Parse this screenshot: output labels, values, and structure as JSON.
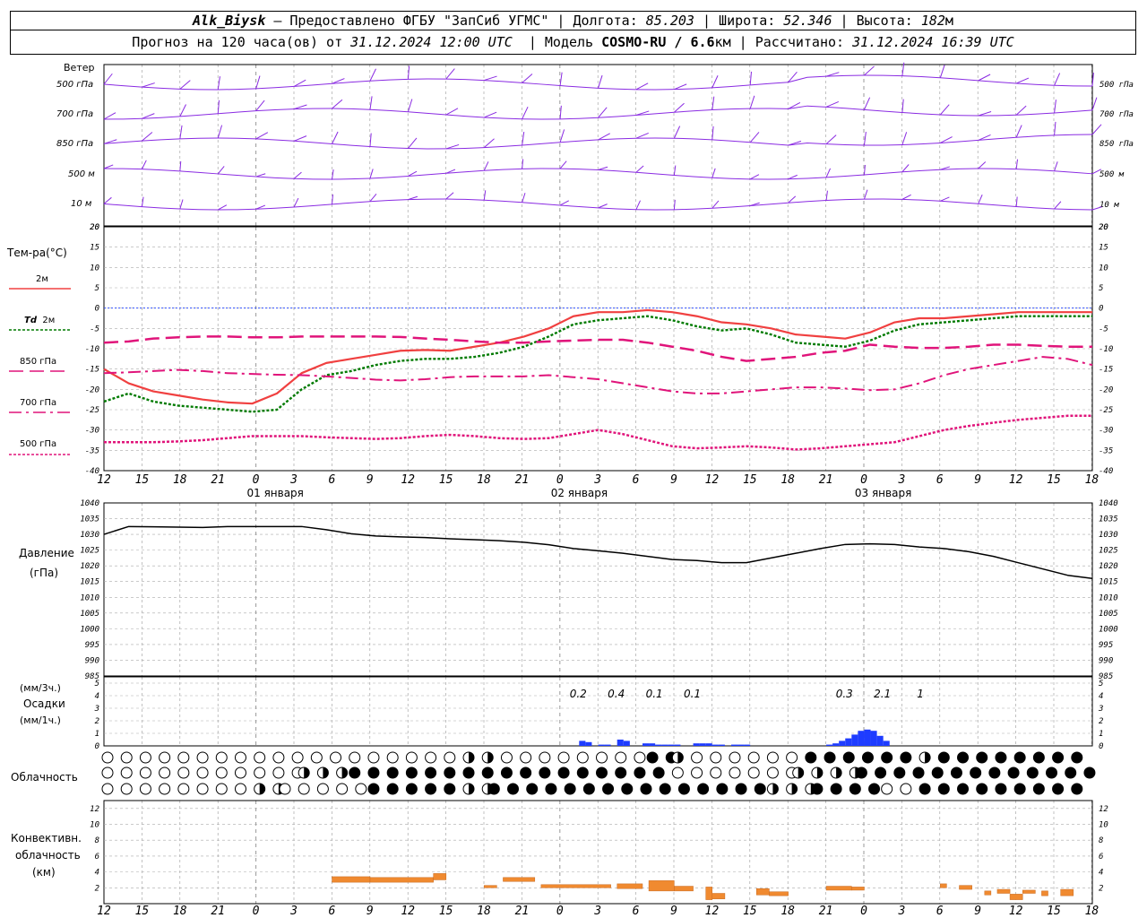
{
  "header": {
    "station": "Alk_Biysk",
    "provided_by": "— Предоставлено ФГБУ \"ЗапСиб УГМС\"",
    "lon_label": "Долгота:",
    "lon_value": "85.203",
    "lat_label": "Широта:",
    "lat_value": "52.346",
    "alt_label": "Высота:",
    "alt_value": "182",
    "alt_unit": "м",
    "forecast_prefix": "Прогноз на 120 часа(ов) от",
    "forecast_start": "31.12.2024 12:00 UTC",
    "model_label": "Модель",
    "model_name": "COSMO-RU / 6.6",
    "model_unit": "км",
    "calc_label": "Рассчитано:",
    "calc_time": "31.12.2024 16:39 UTC"
  },
  "labels": {
    "wind": "Ветер",
    "wind_levels": [
      "500 гПа",
      "700 гПа",
      "850 гПа",
      "500 м",
      "10 м"
    ],
    "temp": "Тем-ра(°C)",
    "t2m": "2м",
    "td_prefix": "Td",
    "td2m": "2м",
    "t850": "850 гПа",
    "t700": "700 гПа",
    "t500": "500 гПа",
    "pressure": "Давление",
    "pressure_unit": "(гПа)",
    "precip_3h": "(мм/3ч.)",
    "precip": "Осадки",
    "precip_1h": "(мм/1ч.)",
    "cloud": "Облачность",
    "conv1": "Конвективн.",
    "conv2": "облачность",
    "conv3": "(км)"
  },
  "colors": {
    "wind": "#8a2be2",
    "t2m": "#f04040",
    "td2m": "#007a00",
    "level": "#e0147a",
    "zero": "#3050ff",
    "precip": "#1e3cff",
    "conv": "#f08a30"
  },
  "time_axis": {
    "hour_ticks": [
      "12",
      "15",
      "18",
      "21",
      "0",
      "3",
      "6",
      "9",
      "12",
      "15",
      "18",
      "21",
      "0",
      "3",
      "6",
      "9",
      "12",
      "15",
      "18",
      "21",
      "0",
      "3",
      "6",
      "9",
      "12",
      "15",
      "18"
    ],
    "days": [
      {
        "label": "01 января",
        "after_tick": 8
      },
      {
        "label": "02 января",
        "after_tick": 16
      },
      {
        "label": "03 января",
        "after_tick": 24
      }
    ],
    "midnight_ticks": [
      4,
      12,
      20
    ]
  },
  "chart_data": [
    {
      "type": "line",
      "title": "Тем-ра(°C)",
      "ylim": [
        -40,
        20
      ],
      "yticks": [
        20,
        15,
        10,
        5,
        0,
        -5,
        -10,
        -15,
        -20,
        -25,
        -30,
        -35,
        -40
      ],
      "x_hours_from_start": [
        0,
        3,
        6,
        9,
        12,
        15,
        18,
        21,
        24,
        27,
        30,
        33,
        36,
        39,
        42,
        45,
        48,
        51,
        54,
        57,
        60,
        63,
        66,
        69,
        72,
        75,
        78,
        81,
        84,
        87,
        90,
        93,
        96,
        99,
        102,
        105,
        108,
        111,
        114,
        117,
        120
      ],
      "series": [
        {
          "name": "2м",
          "values": [
            -15,
            -18.5,
            -20.5,
            -21.5,
            -22.5,
            -23.2,
            -23.5,
            -21,
            -16,
            -13.5,
            -12.5,
            -11.5,
            -10.5,
            -10.3,
            -10.5,
            -9.5,
            -8.5,
            -7,
            -5,
            -2,
            -1,
            -1,
            -0.5,
            -1,
            -2,
            -3.5,
            -4,
            -5,
            -6.5,
            -7,
            -7.5,
            -6,
            -3.5,
            -2.5,
            -2.5,
            -2,
            -1.5,
            -1,
            -1,
            -1,
            -1
          ]
        },
        {
          "name": "Td 2м",
          "values": [
            -23,
            -21,
            -23,
            -24,
            -24.5,
            -25,
            -25.5,
            -25,
            -20,
            -16.5,
            -15.5,
            -14,
            -13,
            -12.5,
            -12.5,
            -12,
            -11,
            -9.5,
            -7,
            -4,
            -3,
            -2.5,
            -2,
            -3,
            -4.5,
            -5.5,
            -5,
            -6.5,
            -8.5,
            -9,
            -9.5,
            -8,
            -5.5,
            -4,
            -3.5,
            -3,
            -2.5,
            -2,
            -2,
            -2,
            -2
          ]
        },
        {
          "name": "850 гПа",
          "values": [
            -8.5,
            -8.2,
            -7.5,
            -7.2,
            -7,
            -7,
            -7.2,
            -7.2,
            -7,
            -7,
            -7,
            -7,
            -7.1,
            -7.5,
            -7.8,
            -8.2,
            -8.5,
            -8.5,
            -8.2,
            -8,
            -7.8,
            -7.8,
            -8.5,
            -9.5,
            -10.5,
            -12,
            -13,
            -12.5,
            -12,
            -11,
            -10.5,
            -9,
            -9.5,
            -9.8,
            -9.8,
            -9.5,
            -9,
            -9,
            -9.3,
            -9.5,
            -9.5
          ]
        },
        {
          "name": "700 гПа",
          "values": [
            -16,
            -15.8,
            -15.5,
            -15.2,
            -15.5,
            -16,
            -16.2,
            -16.4,
            -16.5,
            -16.8,
            -17.2,
            -17.6,
            -17.8,
            -17.5,
            -17,
            -16.8,
            -16.8,
            -16.8,
            -16.5,
            -17,
            -17.5,
            -18.5,
            -19.5,
            -20.5,
            -21,
            -21,
            -20.5,
            -20,
            -19.5,
            -19.5,
            -19.8,
            -20.2,
            -20,
            -18.5,
            -16.5,
            -15,
            -14,
            -13,
            -12,
            -12.5,
            -14
          ]
        },
        {
          "name": "500 гПа",
          "values": [
            -33,
            -33,
            -33,
            -32.8,
            -32.5,
            -32,
            -31.5,
            -31.5,
            -31.5,
            -31.8,
            -32,
            -32.2,
            -32,
            -31.5,
            -31.2,
            -31.5,
            -32,
            -32.2,
            -32,
            -31,
            -30,
            -31,
            -32.5,
            -34,
            -34.5,
            -34.3,
            -34,
            -34.3,
            -34.8,
            -34.5,
            -34,
            -33.5,
            -33,
            -31.5,
            -30,
            -29,
            -28.2,
            -27.5,
            -27,
            -26.5,
            -26.5
          ]
        }
      ]
    },
    {
      "type": "line",
      "title": "Давление",
      "ylabel": "(гПа)",
      "ylim": [
        985,
        1040
      ],
      "yticks": [
        1040,
        1035,
        1030,
        1025,
        1020,
        1015,
        1010,
        1005,
        1000,
        995,
        990,
        985
      ],
      "x_hours_from_start": [
        0,
        3,
        6,
        9,
        12,
        15,
        18,
        21,
        24,
        27,
        30,
        33,
        36,
        39,
        42,
        45,
        48,
        51,
        54,
        57,
        60,
        63,
        66,
        69,
        72,
        75,
        78,
        81,
        84,
        87,
        90,
        93,
        96,
        99,
        102,
        105,
        108,
        111,
        114,
        117,
        120
      ],
      "series": [
        {
          "name": "Давление",
          "values": [
            1030,
            1032.5,
            1032.4,
            1032.3,
            1032.2,
            1032.5,
            1032.5,
            1032.5,
            1032.5,
            1031.5,
            1030.2,
            1029.5,
            1029.2,
            1029,
            1028.6,
            1028.3,
            1028,
            1027.5,
            1026.7,
            1025.5,
            1024.8,
            1024,
            1023,
            1022,
            1021.7,
            1021,
            1021,
            1022.5,
            1024,
            1025.5,
            1026.8,
            1027,
            1026.8,
            1026,
            1025.5,
            1024.5,
            1023,
            1021,
            1019,
            1017,
            1016
          ]
        }
      ]
    },
    {
      "type": "bar",
      "title": "Осадки",
      "ylabel": "(мм/1ч.)",
      "ylim": [
        0,
        5
      ],
      "yticks": [
        5,
        4,
        3,
        2,
        1,
        0
      ],
      "x_hours_from_start": [
        75,
        76,
        78,
        79,
        81,
        82,
        85,
        86,
        87,
        88,
        89,
        90,
        93,
        94,
        95,
        96,
        97,
        99,
        100,
        101,
        114,
        115,
        116,
        117,
        118,
        119,
        120,
        121,
        122,
        123
      ],
      "values": [
        0.4,
        0.3,
        0.1,
        0.1,
        0.5,
        0.4,
        0.2,
        0.2,
        0.1,
        0.1,
        0.1,
        0.1,
        0.2,
        0.2,
        0.2,
        0.1,
        0.1,
        0.1,
        0.1,
        0.1,
        0.1,
        0.2,
        0.4,
        0.6,
        0.9,
        1.2,
        1.3,
        1.2,
        0.8,
        0.4
      ],
      "sums_3h": [
        {
          "hour": 75,
          "value": "0.2"
        },
        {
          "hour": 81,
          "value": "0.4"
        },
        {
          "hour": 87,
          "value": "0.1"
        },
        {
          "hour": 93,
          "value": "0.1"
        },
        {
          "hour": 117,
          "value": "0.3"
        },
        {
          "hour": 123,
          "value": "2.1"
        },
        {
          "hour": 129,
          "value": "1"
        }
      ]
    },
    {
      "type": "bar",
      "title": "Конвективн. облачность",
      "ylabel": "(км)",
      "ylim": [
        0,
        13
      ],
      "yticks": [
        12,
        10,
        8,
        6,
        4,
        2
      ],
      "segments": [
        {
          "x0": 36,
          "x1": 42,
          "lo": 2.7,
          "hi": 3.4
        },
        {
          "x0": 42,
          "x1": 52,
          "lo": 2.7,
          "hi": 3.3
        },
        {
          "x0": 52,
          "x1": 54,
          "lo": 3.0,
          "hi": 3.8
        },
        {
          "x0": 60,
          "x1": 62,
          "lo": 2.0,
          "hi": 2.3
        },
        {
          "x0": 63,
          "x1": 68,
          "lo": 2.8,
          "hi": 3.3
        },
        {
          "x0": 69,
          "x1": 80,
          "lo": 2.0,
          "hi": 2.4
        },
        {
          "x0": 81,
          "x1": 85,
          "lo": 1.9,
          "hi": 2.5
        },
        {
          "x0": 86,
          "x1": 90,
          "lo": 1.6,
          "hi": 2.9
        },
        {
          "x0": 90,
          "x1": 93,
          "lo": 1.6,
          "hi": 2.2
        },
        {
          "x0": 95,
          "x1": 96,
          "lo": 0.5,
          "hi": 2.1
        },
        {
          "x0": 96,
          "x1": 98,
          "lo": 0.6,
          "hi": 1.3
        },
        {
          "x0": 103,
          "x1": 105,
          "lo": 1.1,
          "hi": 1.9
        },
        {
          "x0": 105,
          "x1": 108,
          "lo": 1.0,
          "hi": 1.5
        },
        {
          "x0": 114,
          "x1": 118,
          "lo": 1.7,
          "hi": 2.2
        },
        {
          "x0": 118,
          "x1": 120,
          "lo": 1.7,
          "hi": 2.1
        },
        {
          "x0": 132,
          "x1": 133,
          "lo": 2.0,
          "hi": 2.5
        },
        {
          "x0": 135,
          "x1": 137,
          "lo": 1.8,
          "hi": 2.3
        },
        {
          "x0": 139,
          "x1": 140,
          "lo": 1.1,
          "hi": 1.6
        },
        {
          "x0": 141,
          "x1": 143,
          "lo": 1.3,
          "hi": 1.8
        },
        {
          "x0": 143,
          "x1": 145,
          "lo": 0.5,
          "hi": 1.2
        },
        {
          "x0": 145,
          "x1": 147,
          "lo": 1.3,
          "hi": 1.7
        },
        {
          "x0": 148,
          "x1": 149,
          "lo": 1.0,
          "hi": 1.6
        },
        {
          "x0": 151,
          "x1": 153,
          "lo": 1.0,
          "hi": 1.8
        }
      ]
    }
  ]
}
